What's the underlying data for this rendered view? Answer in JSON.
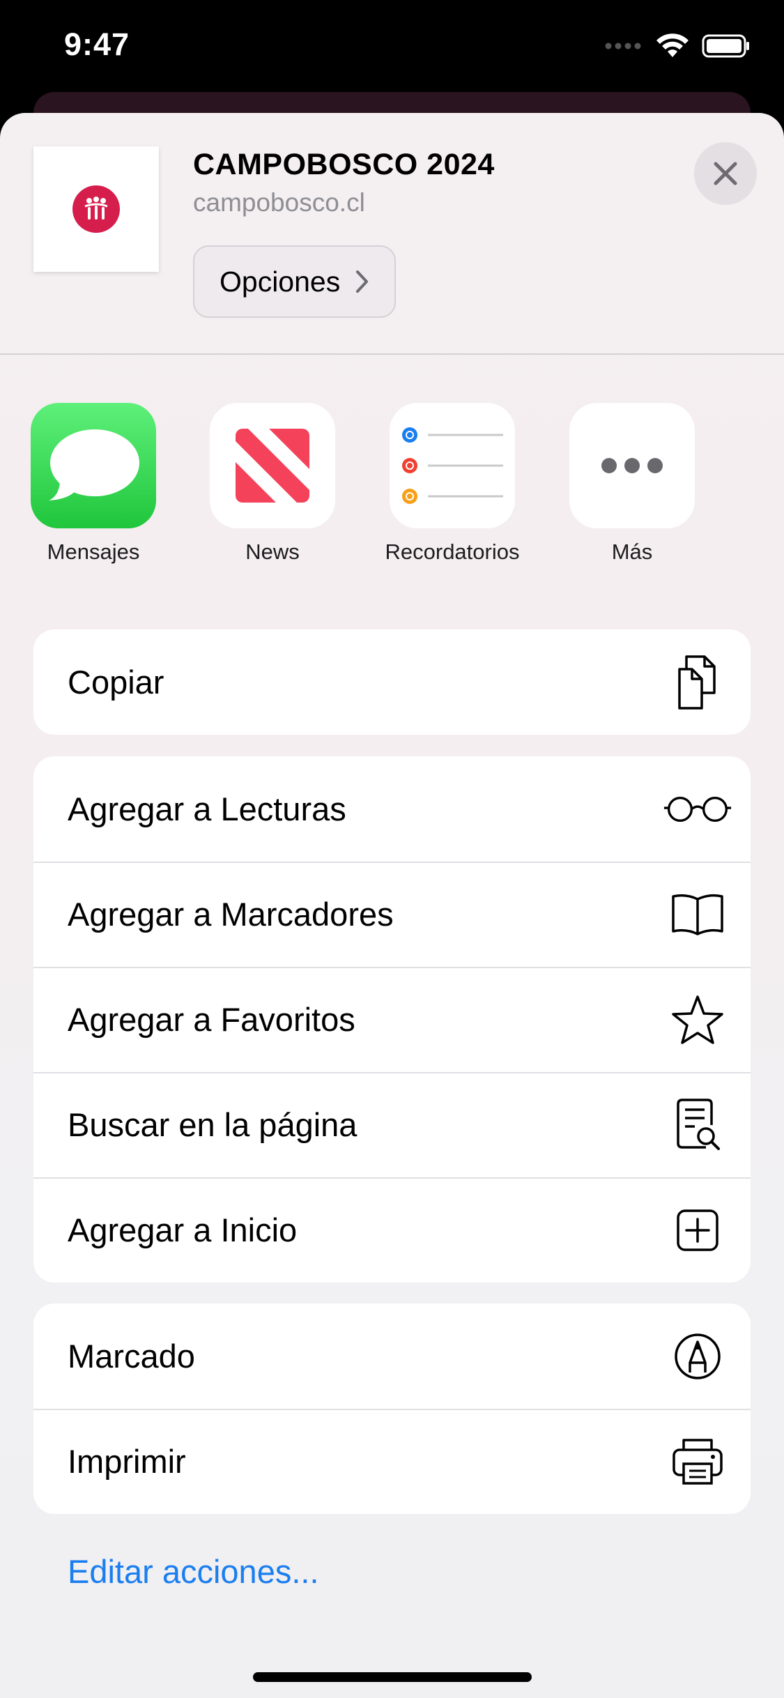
{
  "status_bar": {
    "time": "9:47",
    "icons": [
      "signal-icon",
      "wifi-icon",
      "battery-icon"
    ]
  },
  "share_header": {
    "title": "CAMPOBOSCO 2024",
    "url": "campobosco.cl",
    "options_label": "Opciones",
    "close_icon": "close-icon"
  },
  "apps": [
    {
      "label": "Mensajes",
      "icon": "messages-icon"
    },
    {
      "label": "News",
      "icon": "news-icon"
    },
    {
      "label": "Recordatorios",
      "icon": "reminders-icon"
    },
    {
      "label": "Más",
      "icon": "more-icon"
    }
  ],
  "groups": [
    [
      {
        "label": "Copiar",
        "icon": "copy-icon"
      }
    ],
    [
      {
        "label": "Agregar a Lecturas",
        "icon": "glasses-icon"
      },
      {
        "label": "Agregar a Marcadores",
        "icon": "book-icon"
      },
      {
        "label": "Agregar a Favoritos",
        "icon": "star-icon"
      },
      {
        "label": "Buscar en la página",
        "icon": "find-in-page-icon"
      },
      {
        "label": "Agregar a Inicio",
        "icon": "add-square-icon"
      }
    ],
    [
      {
        "label": "Marcado",
        "icon": "markup-icon"
      },
      {
        "label": "Imprimir",
        "icon": "printer-icon"
      }
    ]
  ],
  "edit_actions_label": "Editar acciones...",
  "colors": {
    "accent": "#1a7ef0",
    "logo": "#d61e4c",
    "messages_green": "#34c759",
    "news_red": "#f4425a"
  }
}
